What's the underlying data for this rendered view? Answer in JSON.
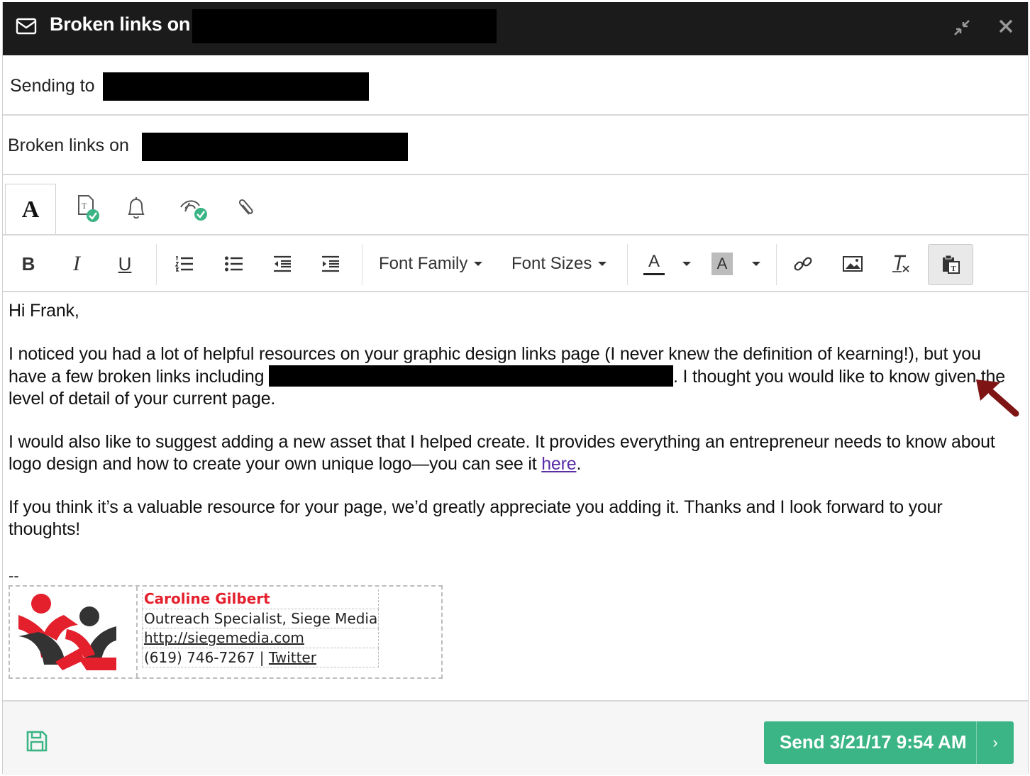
{
  "window": {
    "title": "Broken links on",
    "minimize_icon": "compress-icon",
    "close_icon": "close-icon"
  },
  "recipient": {
    "label": "Sending to"
  },
  "subject": {
    "value": "Broken links on"
  },
  "tabs": [
    {
      "name": "text-format",
      "icon": "A",
      "active": true
    },
    {
      "name": "template-check",
      "icon": "template-check-icon"
    },
    {
      "name": "reminder",
      "icon": "bell-icon"
    },
    {
      "name": "tracking",
      "icon": "tracking-check-icon"
    },
    {
      "name": "attachment",
      "icon": "paperclip-icon"
    }
  ],
  "toolbar": {
    "bold": "B",
    "italic": "I",
    "underline": "U",
    "font_family": "Font Family",
    "font_sizes": "Font Sizes",
    "text_color": "A",
    "bg_color": "A"
  },
  "email": {
    "greeting": "Hi Frank,",
    "p1_a": "I noticed you had a lot of helpful resources on your graphic design links page (I never knew the definition of kearning!), but you have a few broken links including",
    "p1_b": ". I thought you would like to know given the level of detail of your current page.",
    "p2_a": "I would also like to suggest adding a new asset that I helped create. It provides everything an entrepreneur needs to know about logo design and how to create your own unique logo—you can see it",
    "p2_link": "here",
    "p2_b": ".",
    "p3": "If you think it’s a valuable resource for your page, we’d greatly appreciate you adding it. Thanks and I look forward to your thoughts!",
    "sig_dash": "--"
  },
  "signature": {
    "name": "Caroline Gilbert",
    "title": "Outreach Specialist, Siege Media",
    "url": "http://siegemedia.com",
    "phone": "(619) 746-7267",
    "divider": "|",
    "twitter": "Twitter"
  },
  "footer": {
    "save_icon": "save-icon",
    "send_label": "Send 3/21/17 9:54 AM",
    "send_chevron": "›"
  },
  "colors": {
    "titlebar": "#1b1b1b",
    "send": "#3bb585",
    "sig_name": "#e4202d",
    "link": "#5a2ea6",
    "annotation_arrow": "#7e1414"
  }
}
